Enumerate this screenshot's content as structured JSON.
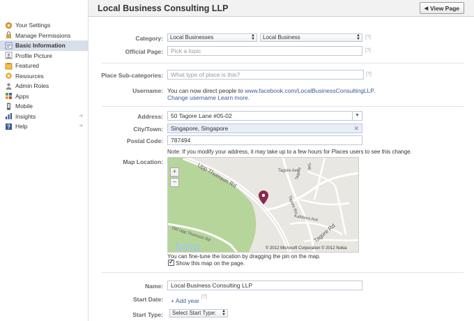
{
  "sidebar": {
    "items": [
      {
        "label": "Your Settings",
        "icon": "settings-icon"
      },
      {
        "label": "Manage Permissions",
        "icon": "permissions-icon"
      },
      {
        "label": "Basic Information",
        "icon": "info-icon"
      },
      {
        "label": "Profile Picture",
        "icon": "picture-icon"
      },
      {
        "label": "Featured",
        "icon": "featured-icon"
      },
      {
        "label": "Resources",
        "icon": "resources-icon"
      },
      {
        "label": "Admin Roles",
        "icon": "admin-icon"
      },
      {
        "label": "Apps",
        "icon": "apps-icon"
      },
      {
        "label": "Mobile",
        "icon": "mobile-icon"
      },
      {
        "label": "Insights",
        "icon": "insights-icon"
      },
      {
        "label": "Help",
        "icon": "help-icon"
      }
    ]
  },
  "header": {
    "title": "Local Business Consulting LLP",
    "view_page": "View Page"
  },
  "form": {
    "category_label": "Category:",
    "category_value": "Local Businesses",
    "subcategory_value": "Local Business",
    "help_mark": "[?]",
    "official_label": "Official Page:",
    "official_placeholder": "Pick a topic",
    "place_sub_label": "Place Sub-categories:",
    "place_sub_placeholder": "What type of place is this?",
    "username_label": "Username:",
    "username_text": "You can now direct people to",
    "username_url": "www.facebook.com/LocalBusinessConsultingLLP.",
    "change_username": "Change username",
    "learn_more": "Learn more.",
    "address_label": "Address:",
    "address_value": "50 Tagore Lane #05-02",
    "city_label": "City/Town:",
    "city_value": "Singapore, Singapore",
    "postal_label": "Postal Code:",
    "postal_value": "787494",
    "note": "Note: If you modify your address, it may take up to a few hours for Places users to see this change.",
    "map_label": "Map Location:",
    "map_hint": "You can fine-tune the location by dragging the pin on the map.",
    "show_map": "Show this map on the page.",
    "name_label": "Name:",
    "name_value": "Local Business Consulting LLP",
    "start_date_label": "Start Date:",
    "add_year": "Add year",
    "start_type_label": "Start Type:",
    "start_type_value": "Select Start Type:"
  },
  "map": {
    "road_labels": [
      "Upp Thomson Rd",
      "Old Upp Thomson Rd",
      "Tagore Ave",
      "Tagore Rd",
      "Kalidasa Ave",
      "Tagore Rd",
      "Tag",
      "Tagore"
    ],
    "zoom_in": "+",
    "zoom_out": "−",
    "brand": "bing",
    "copyright": "© 2012 Microsoft Corporation  © 2012 Nokia",
    "colors": {
      "park": "#b5d39a",
      "land": "#e8e6e1",
      "road": "#ffffff",
      "pin": "#8b2a4a"
    }
  }
}
